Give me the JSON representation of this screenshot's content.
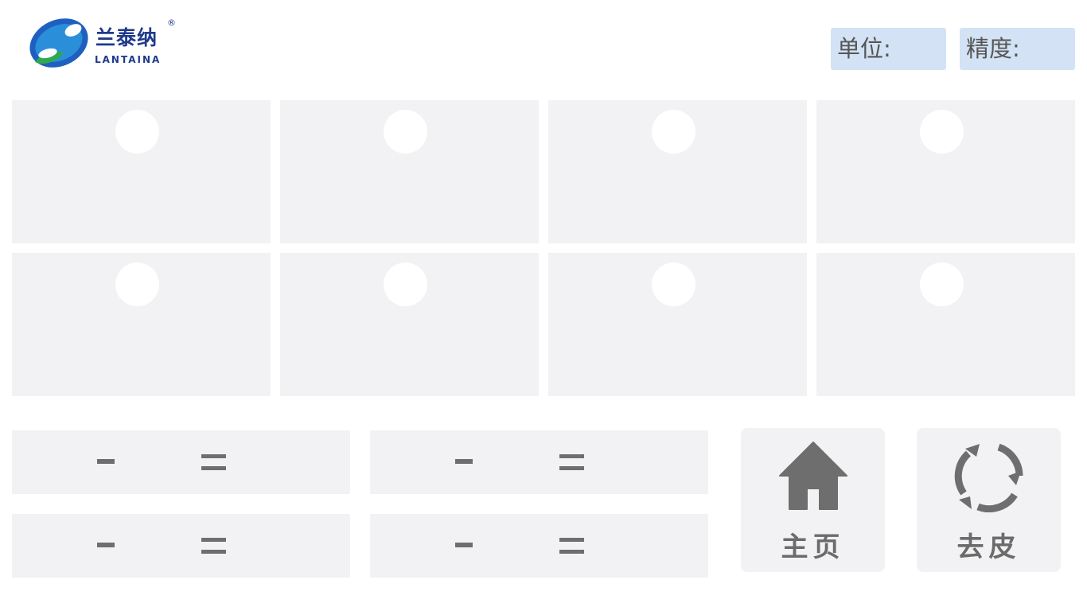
{
  "header": {
    "logo": {
      "name_cn": "兰泰纳",
      "name_en": "LANTAINA",
      "registered_mark": "®"
    },
    "unit_label": "单位:",
    "precision_label": "精度:"
  },
  "colors": {
    "background": "#ffffff",
    "panel": "#f2f2f4",
    "info_box": "#d3e2f4",
    "icon_gray": "#6e6e6e",
    "brand_blue": "#1f3a8c",
    "brand_green": "#2fa84f"
  },
  "channels": {
    "row1": [
      {
        "indicator": "white-circle"
      },
      {
        "indicator": "white-circle"
      },
      {
        "indicator": "white-circle"
      },
      {
        "indicator": "white-circle"
      }
    ],
    "row2": [
      {
        "indicator": "white-circle"
      },
      {
        "indicator": "white-circle"
      },
      {
        "indicator": "white-circle"
      },
      {
        "indicator": "white-circle"
      }
    ]
  },
  "equations": [
    {
      "operator": "minus",
      "result_symbol": "equals"
    },
    {
      "operator": "minus",
      "result_symbol": "equals"
    },
    {
      "operator": "minus",
      "result_symbol": "equals"
    },
    {
      "operator": "minus",
      "result_symbol": "equals"
    }
  ],
  "buttons": {
    "home": {
      "label": "主页",
      "icon": "home-icon"
    },
    "tare": {
      "label": "去皮",
      "icon": "refresh-icon"
    }
  }
}
